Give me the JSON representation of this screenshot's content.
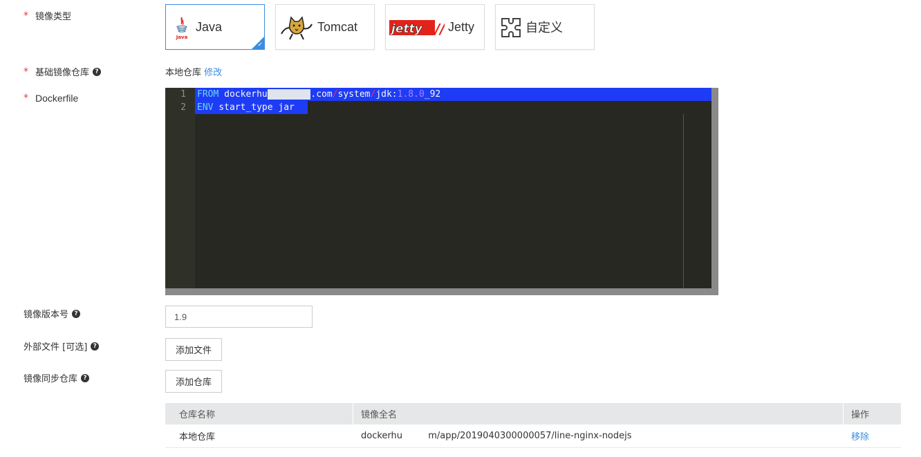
{
  "form": {
    "image_type_label": "镜像类型",
    "base_repo_label": "基础镜像仓库",
    "dockerfile_label": "Dockerfile",
    "version_label": "镜像版本号",
    "external_files_label": "外部文件 [可选]",
    "sync_repo_label": "镜像同步仓库"
  },
  "image_types": [
    {
      "label": "Java",
      "icon": "java-icon",
      "selected": true
    },
    {
      "label": "Tomcat",
      "icon": "tomcat-icon",
      "selected": false
    },
    {
      "label": "Jetty",
      "icon": "jetty-logo",
      "selected": false
    },
    {
      "label": "自定义",
      "icon": "puzzle-icon",
      "selected": false
    }
  ],
  "base_repo": {
    "value": "本地仓库",
    "edit_link": "修改"
  },
  "dockerfile": {
    "lines": [
      {
        "num": "1",
        "text": "FROM dockerhu        .com/system/jdk:1.8.0_92"
      },
      {
        "num": "2",
        "text": "ENV start_type jar"
      }
    ]
  },
  "version": {
    "value": "1.9"
  },
  "buttons": {
    "add_file": "添加文件",
    "add_repo": "添加仓库"
  },
  "repo_table": {
    "headers": [
      "仓库名称",
      "镜像全名",
      "操作"
    ],
    "rows": [
      {
        "name": "本地仓库",
        "full_name": "dockerhu         m/app/2019040300000057/line-nginx-nodejs",
        "action": "移除"
      }
    ]
  },
  "colors": {
    "accent": "#3b8de0",
    "required": "#e63a3a",
    "editor_bg": "#272822",
    "selection": "#1e3cf5"
  }
}
